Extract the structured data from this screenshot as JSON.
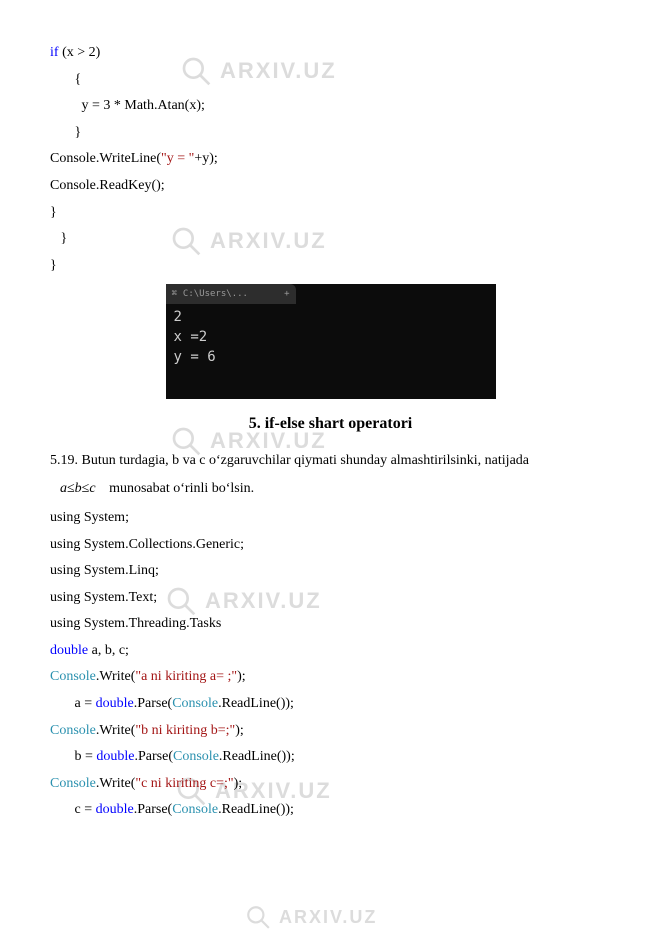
{
  "watermark_text": "ARXIV.UZ",
  "code_block_1": {
    "l1_kw": "if",
    "l1_rest": " (x > 2)",
    "l2": "       {",
    "l3": "         y = 3 * Math.Atan(x);",
    "l4": "       }",
    "l5_a": "Console.WriteLine(",
    "l5_str": "\"y = \"",
    "l5_b": "+y);",
    "l6": "Console.ReadKey();",
    "l7": "}",
    "l8": "   }",
    "l9": "}"
  },
  "terminal": {
    "tab_icon": "⌘",
    "tab_title": "C:\\Users\\...",
    "tab_plus": "+",
    "line1": "2",
    "line2": "x =2",
    "line3": "y = 6"
  },
  "heading": "5. if-else shart operatori",
  "task": {
    "prefix": "5.19.  Butun  turdagia,  b  va  c  oʻzgaruvchilar  qiymati  shunday  almashtirilsinki,  natijada ",
    "formula": "a≤b≤c",
    "suffix": "   munosabat oʻrinli boʻlsin."
  },
  "code_block_2": {
    "u1": "using System;",
    "u2": "using System.Collections.Generic;",
    "u3": "using System.Linq;",
    "u4": "using System.Text;",
    "u5": "using System.Threading.Tasks",
    "d_kw": "double",
    "d_rest": " a, b, c;",
    "w1_cons": "Console",
    "w1_a": ".Write(",
    "w1_str": "\"a ni kiriting a= ;\"",
    "w1_b": ");",
    "p1_a": "       a = ",
    "p1_dbl": "double",
    "p1_b": ".Parse(",
    "p1_cons": "Console",
    "p1_c": ".ReadLine());",
    "w2_cons": "Console",
    "w2_a": ".Write(",
    "w2_str": "\"b ni kiriting b=;\"",
    "w2_b": ");",
    "p2_a": "       b = ",
    "p2_dbl": "double",
    "p2_b": ".Parse(",
    "p2_cons": "Console",
    "p2_c": ".ReadLine());",
    "w3_cons": "Console",
    "w3_a": ".Write(",
    "w3_str": "\"c ni kiriting c=;\"",
    "w3_b": ");",
    "p3_a": "       c = ",
    "p3_dbl": "double",
    "p3_b": ".Parse(",
    "p3_cons": "Console",
    "p3_c": ".ReadLine());"
  }
}
